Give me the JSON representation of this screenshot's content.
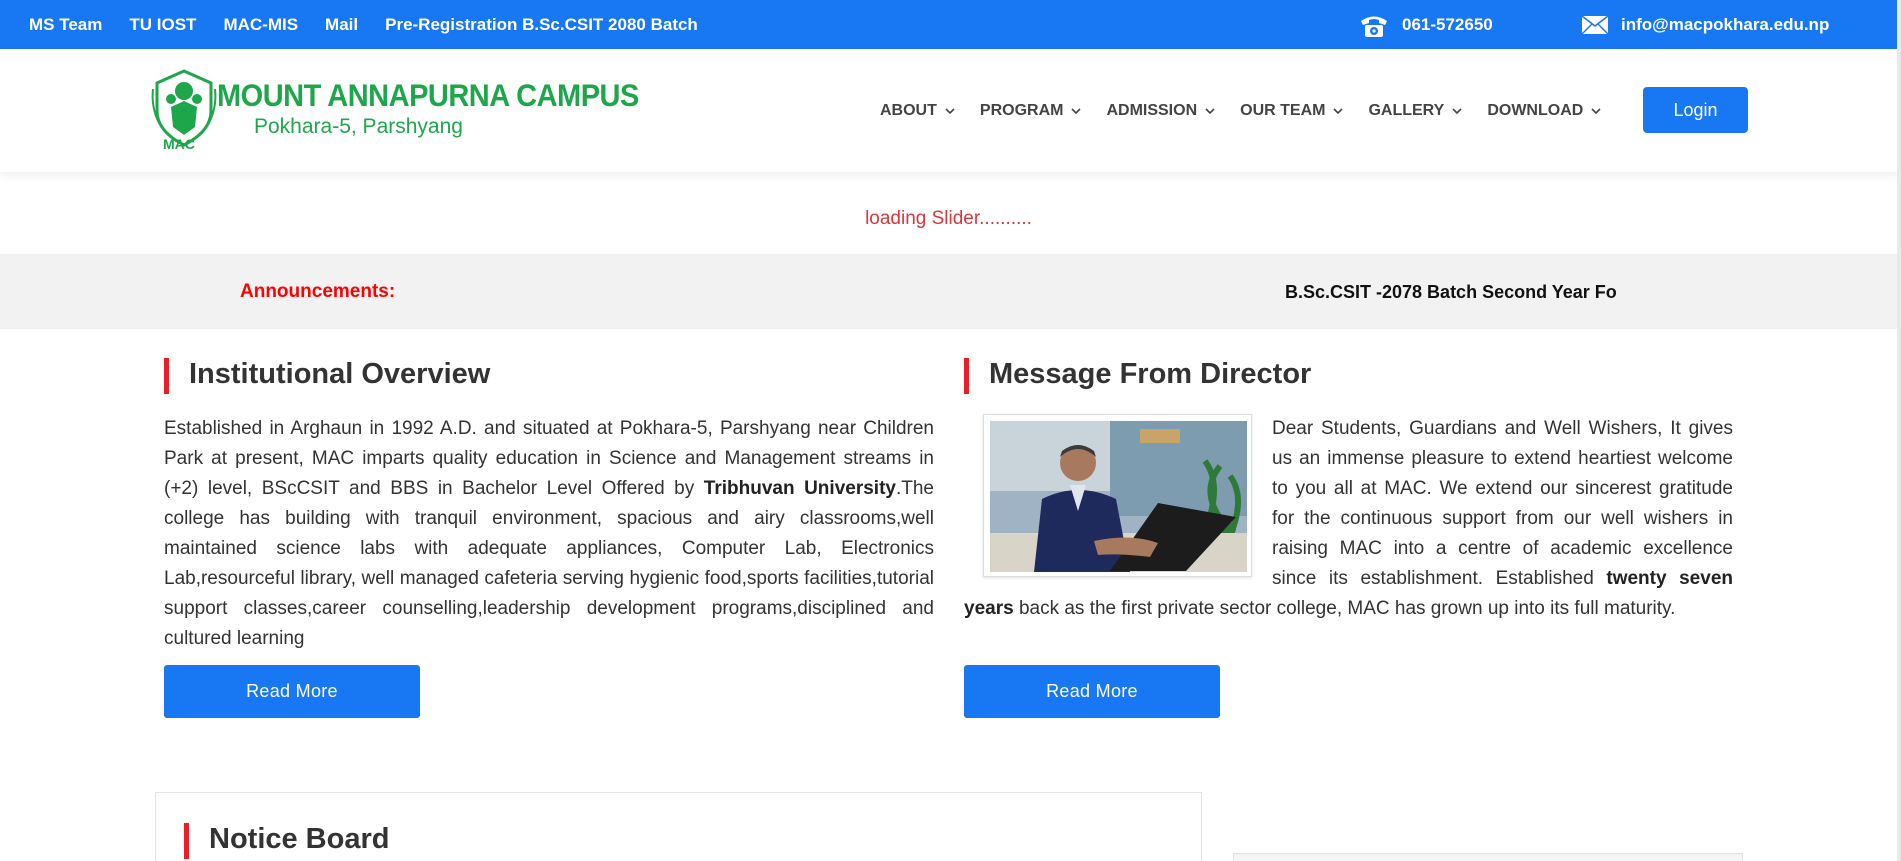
{
  "topbar": {
    "links": [
      "MS Team",
      "TU IOST",
      "MAC-MIS",
      "Mail",
      "Pre-Registration B.Sc.CSIT 2080 Batch"
    ],
    "phone": "061-572650",
    "email": "info@macpokhara.edu.np"
  },
  "logo": {
    "title": "MOUNT ANNAPURNA CAMPUS",
    "subtitle": "Pokhara-5, Parshyang",
    "abbr": "MAC"
  },
  "nav": {
    "items": [
      "ABOUT",
      "PROGRAM",
      "ADMISSION",
      "OUR TEAM",
      "GALLERY",
      "DOWNLOAD"
    ],
    "login_label": "Login"
  },
  "slider": {
    "loading_text": "loading Slider.........."
  },
  "announcements": {
    "label": "Announcements:",
    "ticker": "B.Sc.CSIT -2078 Batch Second Year Fo"
  },
  "overview": {
    "title": "Institutional Overview",
    "text_1": "Established in Arghaun in 1992 A.D. and situated at Pokhara-5, Parshyang near Children Park at present, MAC imparts quality education in Science and Management streams in (+2) level, BScCSIT and BBS in Bachelor Level Offered by ",
    "text_bold": "Tribhuvan University",
    "text_2": ".The college has building with tranquil environment, spacious and airy classrooms,well maintained science labs with adequate appliances, Computer Lab, Electronics Lab,resourceful library, well managed cafeteria serving hygienic food,sports facilities,tutorial support classes,career counselling,leadership development programs,disciplined and cultured learning",
    "button": "Read More"
  },
  "director": {
    "title": "Message From Director",
    "text_1": "Dear Students, Guardians and Well Wishers, It gives us an immense pleasure to extend heartiest welcome to you all at MAC. We extend our sincerest gratitude for the continuous support from our well wishers in raising MAC into a centre of academic excellence since its establishment. Established ",
    "text_bold": "twenty seven years",
    "text_2": " back as the first private sector college, MAC has grown up into its full maturity.",
    "button": "Read More"
  },
  "notice": {
    "title": "Notice Board"
  },
  "colors": {
    "primary": "#1877f2",
    "accent_red": "#ee1c25",
    "logo_green": "#1ea64a"
  }
}
